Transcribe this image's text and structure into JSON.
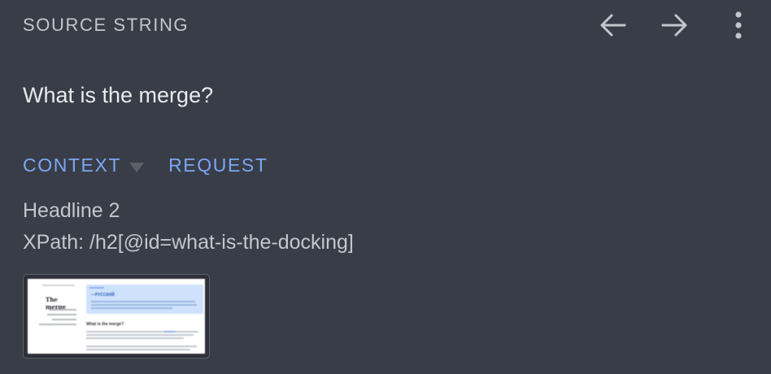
{
  "header": {
    "title": "SOURCE STRING",
    "prev_icon": "arrow-left-icon",
    "next_icon": "arrow-right-icon",
    "menu_icon": "more-vertical-icon"
  },
  "source": {
    "text": "What is the merge?"
  },
  "tabs": {
    "context_label": "CONTEXT",
    "request_label": "REQUEST"
  },
  "context": {
    "element_type": "Headline 2",
    "xpath": "XPath: /h2[@id=what-is-the-docking]"
  },
  "screenshot": {
    "heading": "The merge",
    "banner_title": "—РУССКИЙ",
    "subheading": "What is the merge?"
  },
  "colors": {
    "background": "#393d47",
    "accent": "#7aa7f5",
    "text_primary": "#e8eaed",
    "text_secondary": "#c3c6cc"
  }
}
